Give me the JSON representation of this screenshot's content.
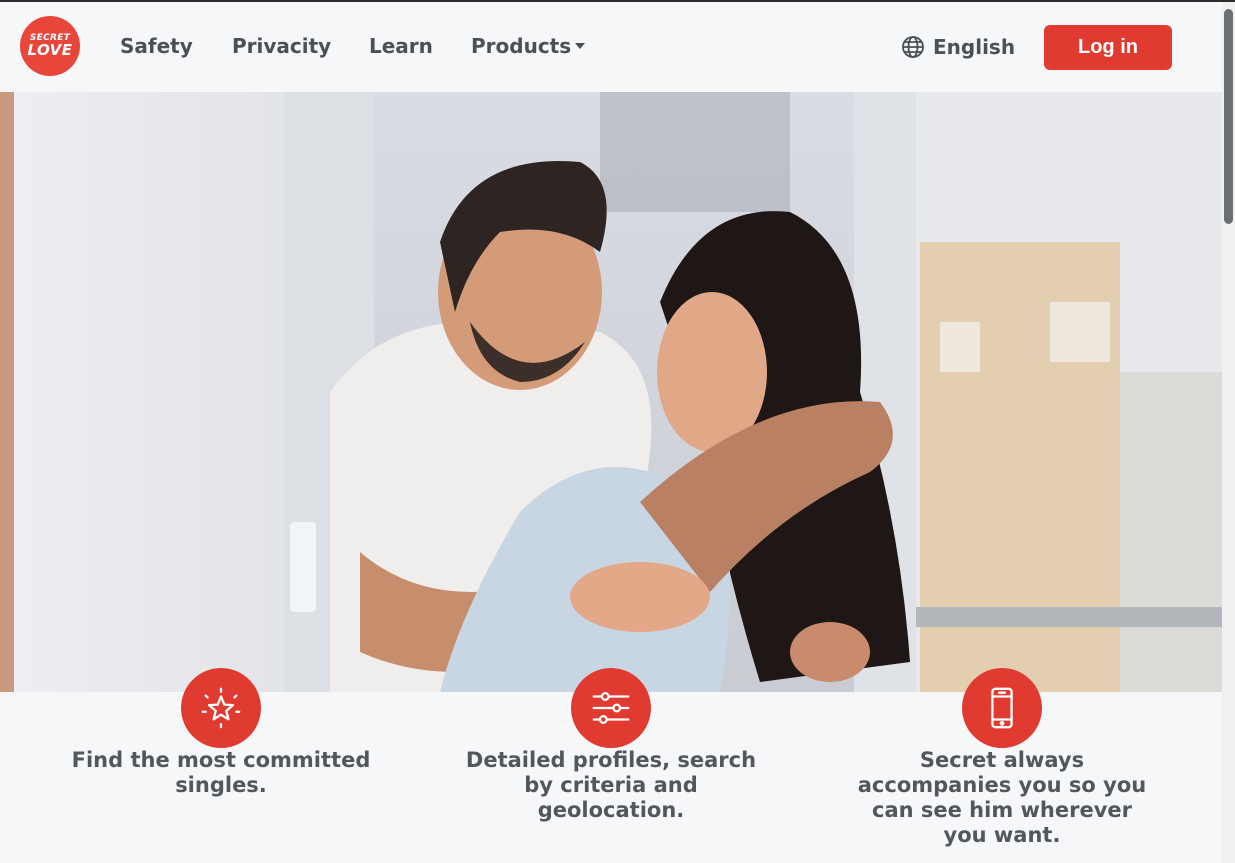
{
  "brand": {
    "logo_line1": "SECRET",
    "logo_line2": "LOVE"
  },
  "nav": {
    "items": [
      {
        "label": "Safety"
      },
      {
        "label": "Privacity"
      },
      {
        "label": "Learn"
      },
      {
        "label": "Products"
      }
    ]
  },
  "language": {
    "label": "English",
    "icon": "globe-icon"
  },
  "login": {
    "label": "Log in"
  },
  "hero": {
    "image": "couple-embracing-photo"
  },
  "features": [
    {
      "icon": "star-sparkle-icon",
      "text": "Find the most committed singles."
    },
    {
      "icon": "sliders-icon",
      "text": "Detailed profiles, search by criteria and geolocation."
    },
    {
      "icon": "smartphone-icon",
      "text": "Secret always accompanies you so you can see him wherever you want."
    }
  ],
  "colors": {
    "accent": "#e03a31",
    "background": "#f6f7f9",
    "text": "#4b4f56"
  }
}
